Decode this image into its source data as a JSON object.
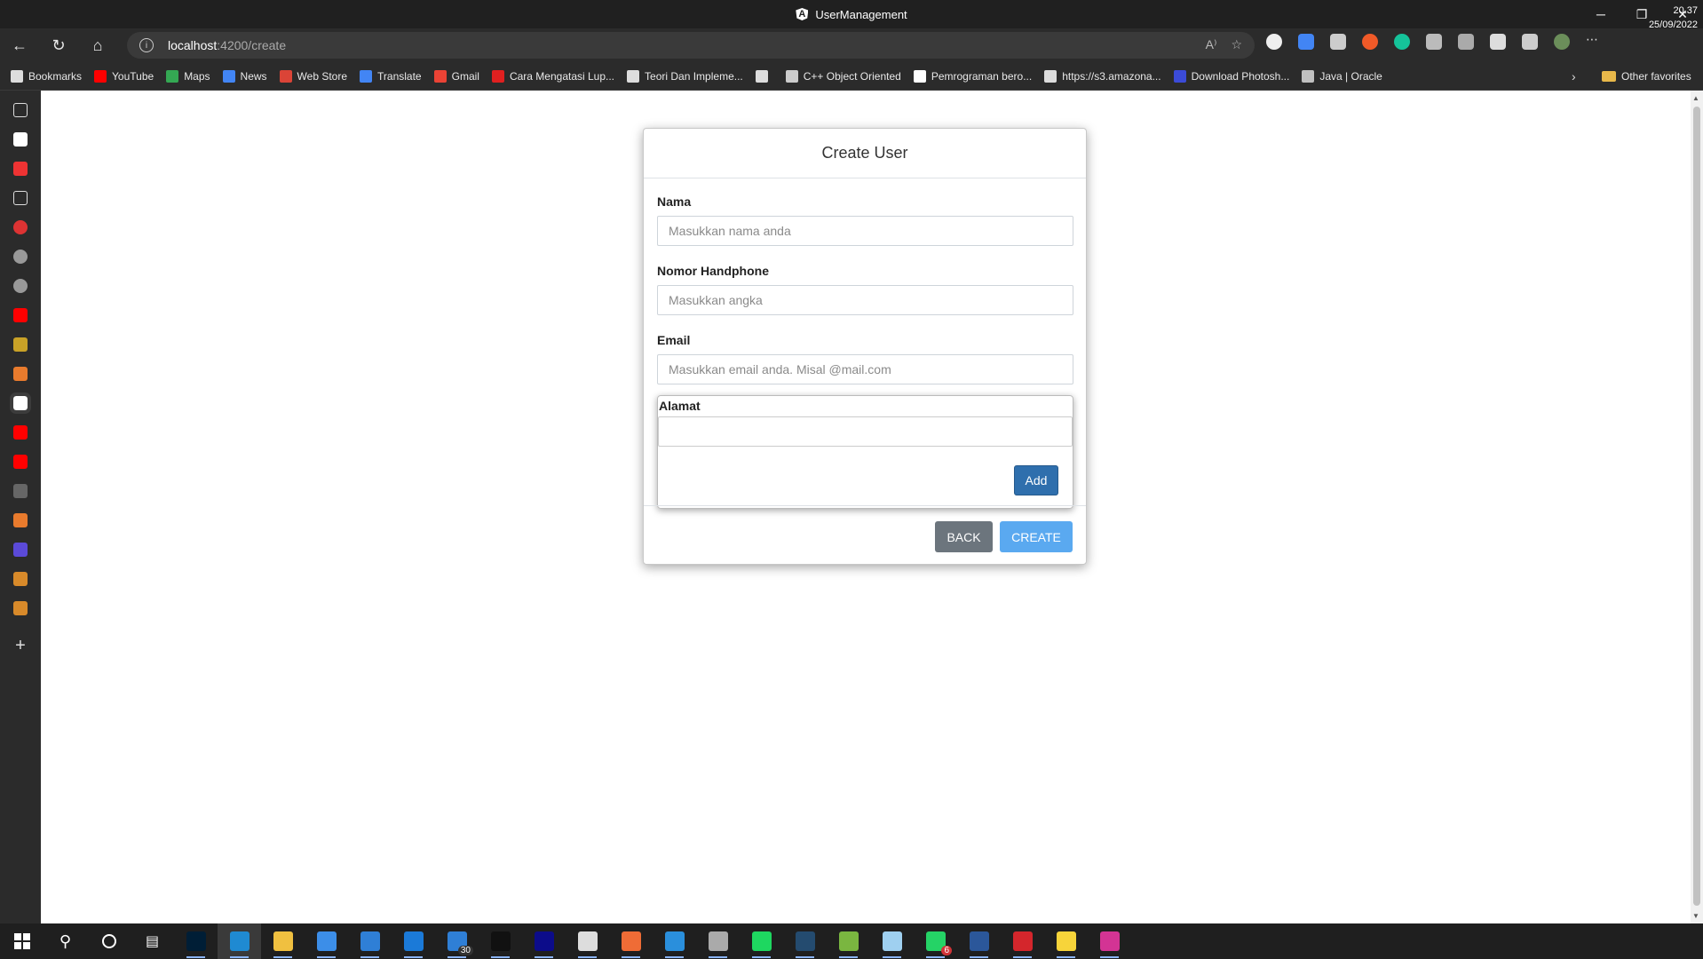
{
  "window": {
    "title": "UserManagement",
    "controls": {
      "minimize": "─",
      "restore": "❐",
      "close": "✕"
    }
  },
  "address": {
    "host": "localhost",
    "path": ":4200/create"
  },
  "bookmarks": [
    {
      "label": "Bookmarks",
      "color": "#dddddd"
    },
    {
      "label": "YouTube",
      "color": "#ff0000"
    },
    {
      "label": "Maps",
      "color": "#34a853"
    },
    {
      "label": "News",
      "color": "#4285f4"
    },
    {
      "label": "Web Store",
      "color": "#db4437"
    },
    {
      "label": "Translate",
      "color": "#4285f4"
    },
    {
      "label": "Gmail",
      "color": "#ea4335"
    },
    {
      "label": "Cara Mengatasi Lup...",
      "color": "#e02020"
    },
    {
      "label": "Teori Dan Impleme...",
      "color": "#dddddd"
    },
    {
      "label": "",
      "color": "#dddddd"
    },
    {
      "label": "C++ Object Oriented",
      "color": "#cccccc"
    },
    {
      "label": "Pemrograman bero...",
      "color": "#ffffff"
    },
    {
      "label": "https://s3.amazona...",
      "color": "#dddddd"
    },
    {
      "label": "Download Photosh...",
      "color": "#3b4bd8"
    },
    {
      "label": "Java | Oracle",
      "color": "#c0c0c0"
    }
  ],
  "other_favorites": "Other favorites",
  "form": {
    "title": "Create User",
    "nama": {
      "label": "Nama",
      "placeholder": "Masukkan nama anda"
    },
    "phone": {
      "label": "Nomor Handphone",
      "placeholder": "Masukkan angka"
    },
    "email": {
      "label": "Email",
      "placeholder": "Masukkan email anda. Misal @mail.com"
    },
    "alamat": {
      "label": "Alamat",
      "value": "",
      "add_label": "Add"
    },
    "back_label": "BACK",
    "create_label": "CREATE"
  },
  "taskbar": {
    "apps": [
      {
        "name": "photoshop",
        "color": "#001e36"
      },
      {
        "name": "edge",
        "color": "#1f8ad2"
      },
      {
        "name": "file-explorer",
        "color": "#f0c040"
      },
      {
        "name": "store",
        "color": "#3c8ee8"
      },
      {
        "name": "mail",
        "color": "#2f7fd6"
      },
      {
        "name": "app",
        "color": "#1b7ad8"
      },
      {
        "name": "calendar",
        "color": "#2f7fd6",
        "badge": "30"
      },
      {
        "name": "terminal",
        "color": "#111111"
      },
      {
        "name": "notion",
        "color": "#0c0c8a"
      },
      {
        "name": "settings",
        "color": "#dddddd"
      },
      {
        "name": "postman",
        "color": "#ef6c36"
      },
      {
        "name": "vscode",
        "color": "#2a8fdc"
      },
      {
        "name": "vm",
        "color": "#aaaaaa"
      },
      {
        "name": "spotify",
        "color": "#1ed760"
      },
      {
        "name": "mysql-workbench",
        "color": "#244b6f"
      },
      {
        "name": "android-studio",
        "color": "#7ab640"
      },
      {
        "name": "app2",
        "color": "#9fd0f0"
      },
      {
        "name": "whatsapp",
        "color": "#25d366",
        "badge": "6"
      },
      {
        "name": "word",
        "color": "#2b579a"
      },
      {
        "name": "acrobat",
        "color": "#d4262c"
      },
      {
        "name": "sticky-notes",
        "color": "#f7d43a"
      },
      {
        "name": "intellij",
        "color": "#d33494"
      }
    ],
    "time": "20.37",
    "date": "25/09/2022"
  }
}
